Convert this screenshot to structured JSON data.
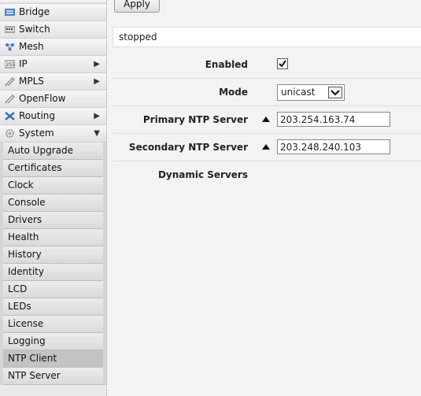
{
  "sidebar": {
    "items": [
      {
        "label": "Bridge",
        "icon": "bridge-icon",
        "arrow": ""
      },
      {
        "label": "Switch",
        "icon": "switch-icon",
        "arrow": ""
      },
      {
        "label": "Mesh",
        "icon": "mesh-icon",
        "arrow": ""
      },
      {
        "label": "IP",
        "icon": "ip-icon",
        "arrow": "▶"
      },
      {
        "label": "MPLS",
        "icon": "mpls-icon",
        "arrow": "▶"
      },
      {
        "label": "OpenFlow",
        "icon": "openflow-icon",
        "arrow": ""
      },
      {
        "label": "Routing",
        "icon": "routing-icon",
        "arrow": "▶"
      },
      {
        "label": "System",
        "icon": "gear-icon",
        "arrow": "▼"
      }
    ],
    "system_subitems": [
      "Auto Upgrade",
      "Certificates",
      "Clock",
      "Console",
      "Drivers",
      "Health",
      "History",
      "Identity",
      "LCD",
      "LEDs",
      "License",
      "Logging",
      "NTP Client",
      "NTP Server"
    ],
    "active_subitem": "NTP Client"
  },
  "toolbar": {
    "apply_label": "Apply"
  },
  "status": "stopped",
  "form": {
    "enabled_label": "Enabled",
    "enabled_checked": true,
    "mode_label": "Mode",
    "mode_value": "unicast",
    "primary_label": "Primary NTP Server",
    "primary_value": "203.254.163.74",
    "secondary_label": "Secondary NTP Server",
    "secondary_value": "203.248.240.103",
    "dynamic_label": "Dynamic Servers"
  }
}
